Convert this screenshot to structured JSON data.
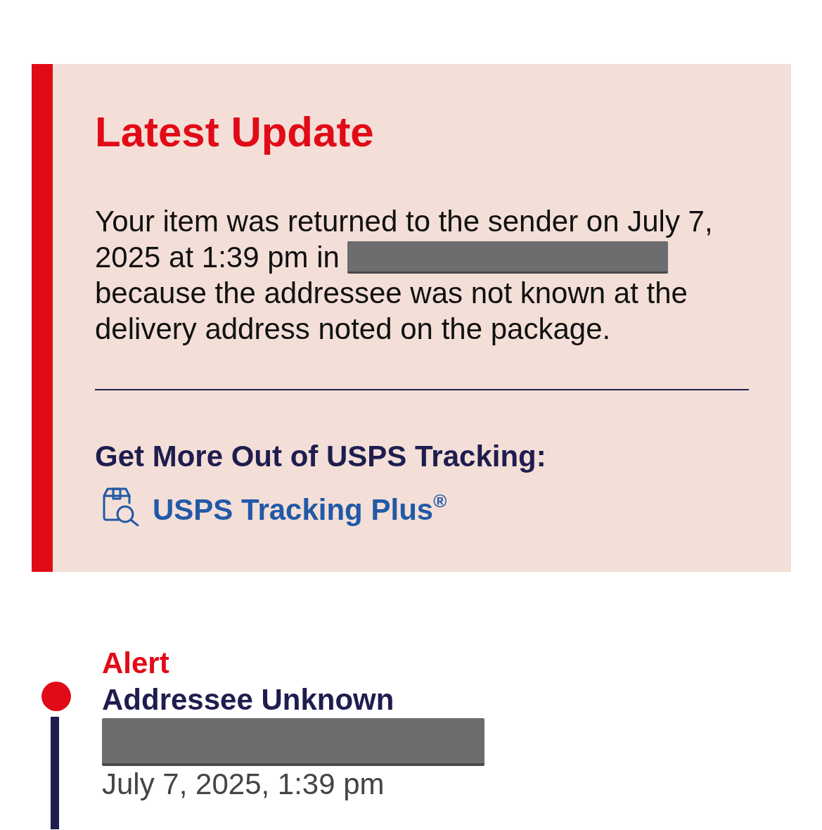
{
  "latest_update": {
    "title": "Latest Update",
    "message": [
      {
        "kind": "text",
        "text": "Your item was returned to the sender on July 7,"
      },
      {
        "kind": "text",
        "text": "2025 at 1:39 pm in"
      },
      {
        "kind": "redacted"
      },
      {
        "kind": "text",
        "text": "because the addressee was not known at the delivery address noted on the package."
      }
    ],
    "promo_heading": "Get More Out of USPS Tracking:",
    "promo_link": "USPS Tracking Plus$^{®}$"
  },
  "tracking_events": [
    {
      "status": "Alert",
      "title": "Addressee Unknown",
      "location_redacted": true,
      "time": "July 7, 2025, 1:39 pm",
      "color": "#e10b17"
    }
  ]
}
